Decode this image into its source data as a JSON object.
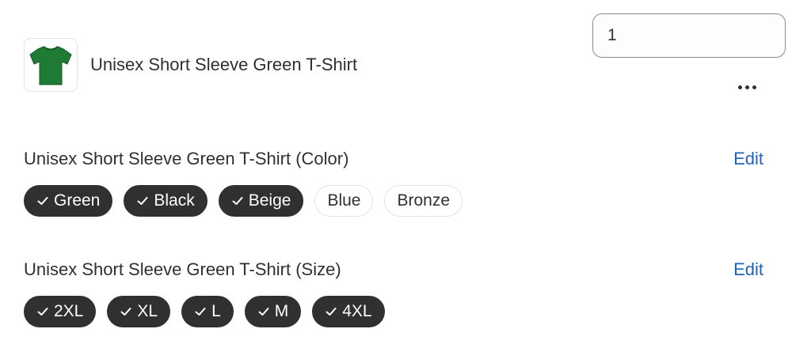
{
  "product": {
    "title": "Unisex Short Sleeve Green T-Shirt",
    "quantity": "1",
    "thumbnail_color": "#1f7a34"
  },
  "options": [
    {
      "title": "Unisex Short Sleeve Green T-Shirt (Color)",
      "edit_label": "Edit",
      "values": [
        {
          "label": "Green",
          "selected": true
        },
        {
          "label": "Black",
          "selected": true
        },
        {
          "label": "Beige",
          "selected": true
        },
        {
          "label": "Blue",
          "selected": false
        },
        {
          "label": "Bronze",
          "selected": false
        }
      ]
    },
    {
      "title": "Unisex Short Sleeve Green T-Shirt (Size)",
      "edit_label": "Edit",
      "values": [
        {
          "label": "2XL",
          "selected": true
        },
        {
          "label": "XL",
          "selected": true
        },
        {
          "label": "L",
          "selected": true
        },
        {
          "label": "M",
          "selected": true
        },
        {
          "label": "4XL",
          "selected": true
        }
      ]
    }
  ],
  "icons": {
    "more": "more-horizontal-icon",
    "check": "checkmark-icon"
  },
  "colors": {
    "chip_selected_bg": "#303030",
    "link": "#1e63b8"
  }
}
